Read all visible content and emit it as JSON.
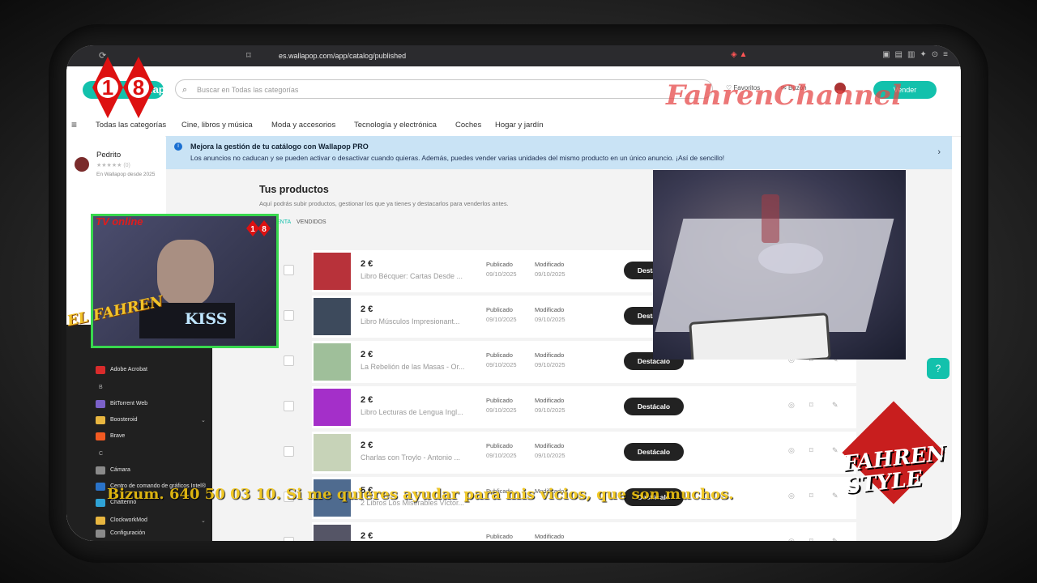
{
  "browser": {
    "url": "es.wallapop.com/app/catalog/published"
  },
  "header": {
    "logo_text": "wallapop",
    "search_placeholder": "Buscar en Todas las categorías",
    "favorites_label": "Favoritos",
    "messages_label": "Buzón",
    "sell_label": "Vender",
    "watermark": "FahrenChannel"
  },
  "categories": [
    "Todas las categorías",
    "Cine, libros y música",
    "Moda y accesorios",
    "Tecnología y electrónica",
    "Coches",
    "Hogar y jardín"
  ],
  "user": {
    "name": "Pedrito",
    "rating_count": "(0)",
    "since": "En Wallapop desde 2025"
  },
  "banner": {
    "title": "Mejora la gestión de tu catálogo con Wallapop PRO",
    "text": "Los anuncios no caducan y se pueden activar o desactivar cuando quieras. Además, puedes vender varias unidades del mismo producto en un único anuncio. ¡Así de sencillo!"
  },
  "page": {
    "title": "Tus productos",
    "subtitle": "Aquí podrás subir productos, gestionar los que ya tienes y destacarlos para venderlos antes.",
    "tab_active": "A LA VENTA",
    "tab_sold": "VENDIDOS"
  },
  "products": [
    {
      "price": "2 €",
      "name": "Libro Bécquer: Cartas Desde ...",
      "published_label": "Publicado",
      "published": "09/10/2025",
      "modified_label": "Modificado",
      "modified": "09/10/2025",
      "boost": "Destácalo",
      "thumb_color": "#b8323a"
    },
    {
      "price": "2 €",
      "name": "Libro Músculos Impresionant...",
      "published_label": "Publicado",
      "published": "09/10/2025",
      "modified_label": "Modificado",
      "modified": "09/10/2025",
      "boost": "Destácalo",
      "thumb_color": "#3d4a5c"
    },
    {
      "price": "2 €",
      "name": "La Rebelión de las Masas - Or...",
      "published_label": "Publicado",
      "published": "09/10/2025",
      "modified_label": "Modificado",
      "modified": "09/10/2025",
      "boost": "Destácalo",
      "thumb_color": "#9fbf9a"
    },
    {
      "price": "2 €",
      "name": "Libro Lecturas de Lengua Ingl...",
      "published_label": "Publicado",
      "published": "09/10/2025",
      "modified_label": "Modificado",
      "modified": "09/10/2025",
      "boost": "Destácalo",
      "thumb_color": "#a42fc9"
    },
    {
      "price": "2 €",
      "name": "Charlas con Troylo - Antonio ...",
      "published_label": "Publicado",
      "published": "09/10/2025",
      "modified_label": "Modificado",
      "modified": "09/10/2025",
      "boost": "Destácalo",
      "thumb_color": "#c7d3b8"
    },
    {
      "price": "5 €",
      "name": "2 Libros Los Miserables Víctor...",
      "published_label": "Publicado",
      "published": "",
      "modified_label": "Modificado",
      "modified": "",
      "boost": "Destácalo",
      "thumb_color": "#4f6b8f"
    },
    {
      "price": "2 €",
      "name": "",
      "published_label": "Publicado",
      "published": "",
      "modified_label": "Modificado",
      "modified": "",
      "boost": "",
      "thumb_color": "#556"
    }
  ],
  "start_menu": {
    "items": [
      {
        "label": "Adobe Acrobat",
        "color": "#d92b2b",
        "kind": "app"
      },
      {
        "label": "B",
        "kind": "header"
      },
      {
        "label": "BitTorrent Web",
        "color": "#7b61c9",
        "kind": "app"
      },
      {
        "label": "Boosteroid",
        "color": "#e8b640",
        "kind": "folder"
      },
      {
        "label": "Brave",
        "color": "#f25a22",
        "kind": "app"
      },
      {
        "label": "C",
        "kind": "header"
      },
      {
        "label": "Cámara",
        "color": "#8a8a8a",
        "kind": "app"
      },
      {
        "label": "Centro de comando de gráficos Intel®",
        "color": "#2a73c9",
        "kind": "app"
      },
      {
        "label": "Chatterino",
        "color": "#2fa3d6",
        "kind": "app"
      },
      {
        "label": "ClockworkMod",
        "color": "#e8b640",
        "kind": "folder"
      },
      {
        "label": "Configuración",
        "color": "#8a8a8a",
        "kind": "app"
      }
    ]
  },
  "overlays": {
    "tv_live": "TV online",
    "badge": "18",
    "el_fahren": "EL FAHREN",
    "kiss": "KISS",
    "ticker": "Bizum. 640 50 03 10. Si me quieres ayudar para mis vicios, que son muchos.",
    "fahren_style": "FAHREN STYLE"
  },
  "icons": {
    "reload": "reload-icon",
    "bookmark": "bookmark-icon",
    "search": "search-icon",
    "heart": "heart-icon",
    "mail": "mail-icon",
    "hamburger": "menu-icon",
    "chevron": "chevron-right-icon",
    "help": "help-chat-icon"
  }
}
